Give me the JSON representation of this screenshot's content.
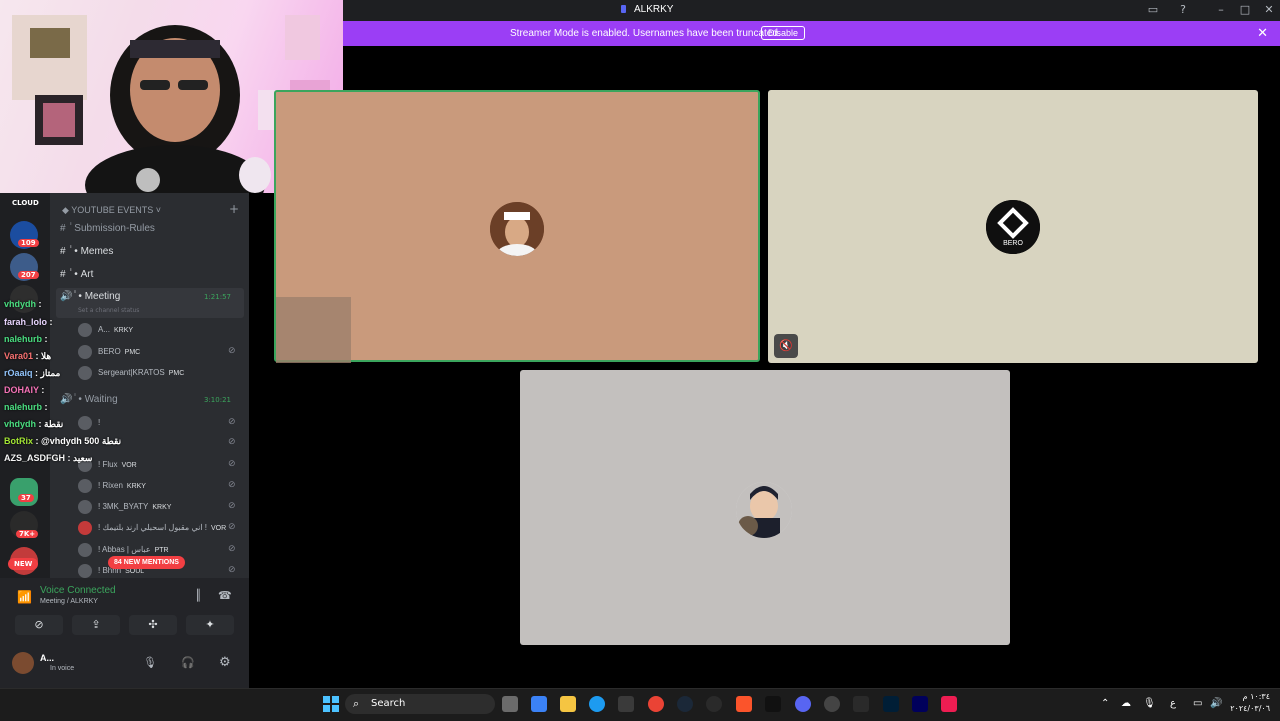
{
  "window": {
    "title": "ALKRKY"
  },
  "banner": {
    "message": "Streamer Mode is enabled. Usernames have been truncated.",
    "button": "Disable"
  },
  "sidebar": {
    "category": "YOUTUBE EVENTS",
    "channels": [
      {
        "name": "Submission-Rules"
      },
      {
        "name": "Memes"
      },
      {
        "name": "Art"
      }
    ],
    "voice_channel": {
      "name": "Meeting",
      "timer": "1:21:57",
      "status_placeholder": "Set a channel status"
    },
    "members": [
      {
        "name": "A...",
        "tag": "KRKY"
      },
      {
        "name": "BERO",
        "tag": "PMC"
      },
      {
        "name": "Sergeant|KRATOS",
        "tag": "PMC"
      }
    ],
    "waiting_channel": {
      "name": "Waiting",
      "timer": "3:10:21"
    },
    "waiting_members": [
      {
        "name": "!",
        "tag": ""
      },
      {
        "name": "",
        "tag": ""
      },
      {
        "name": "! Flux",
        "tag": "VOR"
      },
      {
        "name": "! Rixen",
        "tag": "KRKY"
      },
      {
        "name": "! 3MK_BYATY",
        "tag": "KRKY"
      },
      {
        "name": "! اني مقبول اسحبلي ارند بلتيمك !",
        "tag": "VOR"
      },
      {
        "name": "! Abbas | عباس",
        "tag": "PTR"
      },
      {
        "name": "! Bhnn",
        "tag": "SOUL"
      }
    ],
    "mentions_pill": "84 NEW MENTIONS",
    "guild_badges": [
      "109",
      "207",
      "37",
      "7K+",
      "NEW"
    ],
    "guild_top_label": "CLOUD"
  },
  "chat_overlay": [
    {
      "user": "vhdydh",
      "text": ":",
      "color": "#4ade80"
    },
    {
      "user": "farah_lolo",
      "text": ":",
      "color": "#e9d5ff"
    },
    {
      "user": "nalehurb",
      "text": ":",
      "color": "#4ade80"
    },
    {
      "user": "Vara01",
      "text": ": هلا",
      "color": "#f87171"
    },
    {
      "user": "rOaaiq",
      "text": ": ممتاز",
      "color": "#93c5fd"
    },
    {
      "user": "DOHAIY",
      "text": ":",
      "color": "#f472b6"
    },
    {
      "user": "nalehurb",
      "text": ":",
      "color": "#4ade80"
    },
    {
      "user": "vhdydh",
      "text": ": نقطة",
      "color": "#4ade80"
    },
    {
      "user": "BotRix",
      "text": ": @vhdydh 500 نقطة",
      "color": "#a3e635"
    },
    {
      "user": "AZS_ASDFGH",
      "text": ": سعيد",
      "color": "#f5f5f5"
    }
  ],
  "voice": {
    "status": "Voice Connected",
    "location": "Meeting / ALKRKY"
  },
  "user": {
    "name": "A...",
    "status": "In voice"
  },
  "tiles": [
    {
      "label": ""
    },
    {
      "label": "BERO"
    },
    {
      "label": ""
    }
  ],
  "taskbar": {
    "search_label": "Search",
    "tray_lang": "ع",
    "time": "١٠:٣٤ م",
    "date": "٢٠٢٤/٠٣/٠٦"
  },
  "colors": {
    "streamer_banner": "#9b3ef5",
    "speaking_border": "#3ba55d",
    "mentions": "#f23f43"
  }
}
